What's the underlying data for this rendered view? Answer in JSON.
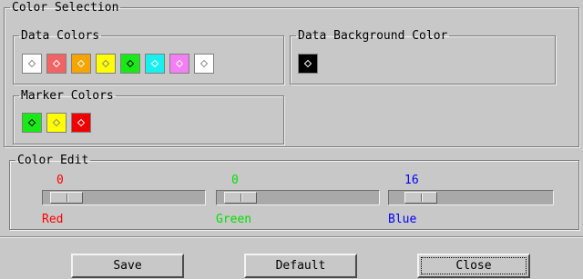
{
  "color_selection": {
    "title": "Color Selection",
    "data_colors": {
      "title": "Data Colors",
      "swatches": [
        {
          "name": "white",
          "color": "#ffffff",
          "mark": "#8a8a8a"
        },
        {
          "name": "light-red",
          "color": "#f26464",
          "mark": "#ffffff"
        },
        {
          "name": "orange",
          "color": "#f5a400",
          "mark": "#ffffff"
        },
        {
          "name": "yellow",
          "color": "#ffff00",
          "mark": "#8a8a8a"
        },
        {
          "name": "green",
          "color": "#18ea18",
          "mark": "#000000"
        },
        {
          "name": "cyan",
          "color": "#18f0f0",
          "mark": "#ffffff"
        },
        {
          "name": "pink",
          "color": "#f47ff4",
          "mark": "#ffffff"
        },
        {
          "name": "white-2",
          "color": "#ffffff",
          "mark": "#8a8a8a"
        }
      ]
    },
    "data_background": {
      "title": "Data Background Color",
      "swatches": [
        {
          "name": "black",
          "color": "#000000",
          "mark": "#ffffff"
        }
      ]
    },
    "marker_colors": {
      "title": "Marker Colors",
      "swatches": [
        {
          "name": "green",
          "color": "#18ea18",
          "mark": "#000000"
        },
        {
          "name": "yellow",
          "color": "#ffff00",
          "mark": "#8a8a8a"
        },
        {
          "name": "red",
          "color": "#f00000",
          "mark": "#ffffff"
        }
      ]
    }
  },
  "color_edit": {
    "title": "Color Edit",
    "channels": [
      {
        "label": "Red",
        "value": "0",
        "color": "#ff0000",
        "fraction": 0.0
      },
      {
        "label": "Green",
        "value": "0",
        "color": "#00e000",
        "fraction": 0.0
      },
      {
        "label": "Blue",
        "value": "16",
        "color": "#0000ff",
        "fraction": 0.063
      }
    ]
  },
  "buttons": {
    "save": "Save",
    "default": "Default",
    "close": "Close"
  }
}
